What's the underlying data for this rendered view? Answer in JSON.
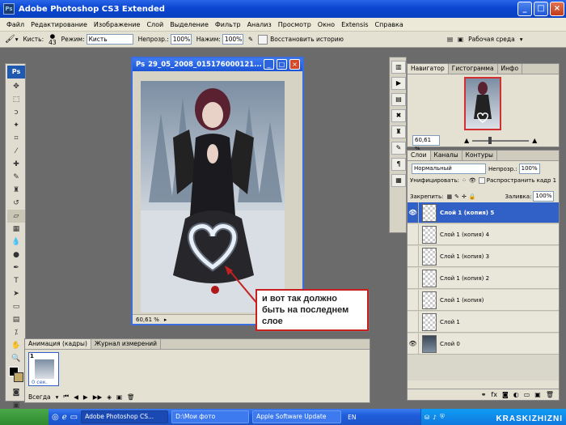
{
  "app": {
    "title": "Adobe Photoshop CS3 Extended",
    "icon": "ps-app-icon"
  },
  "menu": [
    "Файл",
    "Редактирование",
    "Изображение",
    "Слой",
    "Выделение",
    "Фильтр",
    "Анализ",
    "Просмотр",
    "Окно",
    "Extensis",
    "Справка"
  ],
  "options_bar": {
    "brush_label": "Кисть:",
    "brush_size": "43",
    "mode_label": "Режим:",
    "mode_value": "Кисть",
    "opacity_label": "Непрозр.:",
    "opacity_value": "100%",
    "pressure_label": "Нажим:",
    "pressure_value": "100%",
    "restore_history_label": "Восстановить историю",
    "workspace_label": "Рабочая среда"
  },
  "document": {
    "title": "29_05_2008_015176000121...",
    "zoom": "60,61 %"
  },
  "navigator": {
    "tabs": [
      "Навигатор",
      "Гистограмма",
      "Инфо"
    ],
    "zoom": "60,61 %"
  },
  "layers_panel": {
    "tabs": [
      "Слои",
      "Каналы",
      "Контуры"
    ],
    "blend_mode": "Нормальный",
    "opacity_label": "Непрозр.:",
    "opacity_value": "100%",
    "unify_label": "Унифицировать:",
    "propagate_label": "Распространить кадр 1",
    "lock_label": "Закрепить:",
    "fill_label": "Заливка:",
    "fill_value": "100%",
    "layers": [
      {
        "name": "Слой 1 (копия) 5",
        "visible": true,
        "selected": true
      },
      {
        "name": "Слой 1 (копия) 4",
        "visible": false,
        "selected": false
      },
      {
        "name": "Слой 1 (копия) 3",
        "visible": false,
        "selected": false
      },
      {
        "name": "Слой 1 (копия) 2",
        "visible": false,
        "selected": false
      },
      {
        "name": "Слой 1 (копия)",
        "visible": false,
        "selected": false
      },
      {
        "name": "Слой 1",
        "visible": false,
        "selected": false
      },
      {
        "name": "Слой 0",
        "visible": true,
        "selected": false
      }
    ]
  },
  "animation_panel": {
    "tabs": [
      "Анимация (кадры)",
      "Журнал измерений"
    ],
    "frame_number": "1",
    "frame_delay": "0 сек.",
    "loop": "Всегда"
  },
  "callout": {
    "text": "и вот так должно быть на последнем слое",
    "border_color": "#c62020"
  },
  "taskbar": {
    "items": [
      "Adobe Photoshop CS...",
      "D:\\Мои фото",
      "Apple Software Update"
    ],
    "language": "EN"
  },
  "watermark": "KRASKIZHIZNI"
}
